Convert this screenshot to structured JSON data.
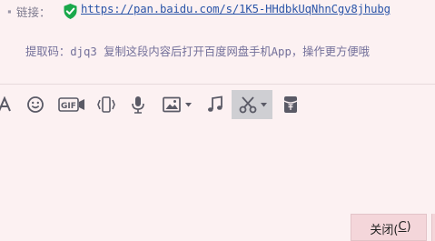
{
  "link": {
    "label": "链接：",
    "url": "https://pan.baidu.com/s/1K5-HHdbkUqNhnCgv8jhubg"
  },
  "extract": {
    "text": "提取码：djq3 复制这段内容后打开百度网盘手机App，操作更方便哦"
  },
  "toolbar": {
    "items": [
      {
        "name": "font-icon"
      },
      {
        "name": "emoji-icon"
      },
      {
        "name": "gif-icon"
      },
      {
        "name": "shake-icon"
      },
      {
        "name": "microphone-icon"
      },
      {
        "name": "image-icon"
      },
      {
        "name": "music-icon"
      },
      {
        "name": "scissors-icon"
      },
      {
        "name": "red-envelope-icon"
      }
    ]
  },
  "footer": {
    "close_label": "关闭(",
    "close_mnemonic": "C",
    "close_suffix": ")"
  }
}
